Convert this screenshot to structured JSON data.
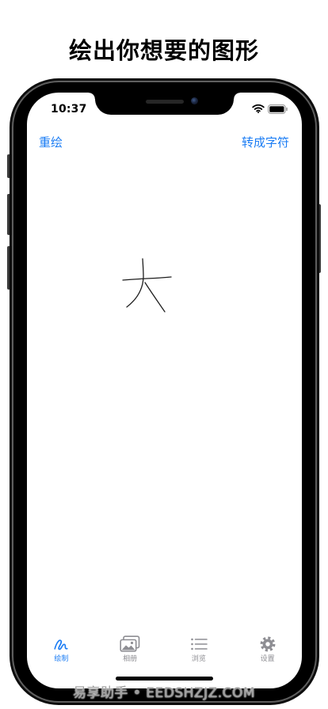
{
  "headline": "绘出你想要的图形",
  "colors": {
    "accent": "#1a7cf4",
    "inactive": "#8e8e93",
    "ink": "#1e1e1e",
    "watermark": "#9b9b9b"
  },
  "status_bar": {
    "time": "10:37",
    "icons": [
      "wifi-icon",
      "battery-icon"
    ]
  },
  "nav": {
    "left_button": "重绘",
    "right_button": "转成字符"
  },
  "tabs": [
    {
      "label": "绘制",
      "icon": "draw-icon",
      "selected": true
    },
    {
      "label": "相册",
      "icon": "photo-album-icon",
      "selected": false
    },
    {
      "label": "浏览",
      "icon": "list-icon",
      "selected": false
    },
    {
      "label": "设置",
      "icon": "gear-icon",
      "selected": false
    }
  ],
  "watermark": "易享助手 • EEDSHZJZ.COM"
}
